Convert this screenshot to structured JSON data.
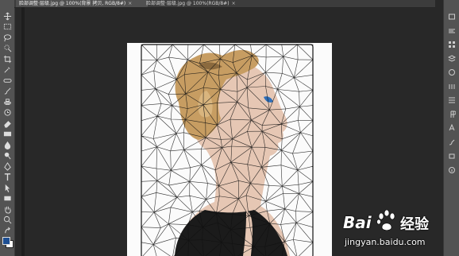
{
  "tabs": [
    {
      "label": "脸部调整·层级.jpg @ 100%(背景 拷贝, RGB/8#)",
      "close": "×",
      "active": true
    },
    {
      "label": "脸部调整·层级.jpg @ 100%(RGB/8#)",
      "close": "×",
      "active": false
    }
  ],
  "panel_toggle": "«",
  "tools": [
    "move-icon",
    "marquee-icon",
    "lasso-icon",
    "quick-select-icon",
    "crop-icon",
    "eyedropper-icon",
    "healing-brush-icon",
    "brush-icon",
    "clone-stamp-icon",
    "history-brush-icon",
    "eraser-icon",
    "gradient-icon",
    "blur-icon",
    "dodge-icon",
    "pen-icon",
    "type-icon",
    "path-select-icon",
    "rectangle-icon",
    "hand-icon",
    "zoom-icon",
    "swap-colors-icon",
    "foreground-color-swatch"
  ],
  "panel_buttons": [
    "history-icon",
    "color-icon",
    "swatches-icon",
    "layers-icon",
    "channels-icon",
    "adjustments-icon",
    "properties-icon",
    "paragraph-icon",
    "character-icon",
    "brush-settings-icon",
    "clone-source-icon",
    "info-icon"
  ],
  "colors": {
    "foreground": "#1e4f93",
    "background": "#ffffff",
    "accent": "#2f7fd3"
  },
  "watermark": {
    "brand_left": "Bai",
    "brand_right": "经验",
    "url": "jingyan.baidu.com"
  }
}
